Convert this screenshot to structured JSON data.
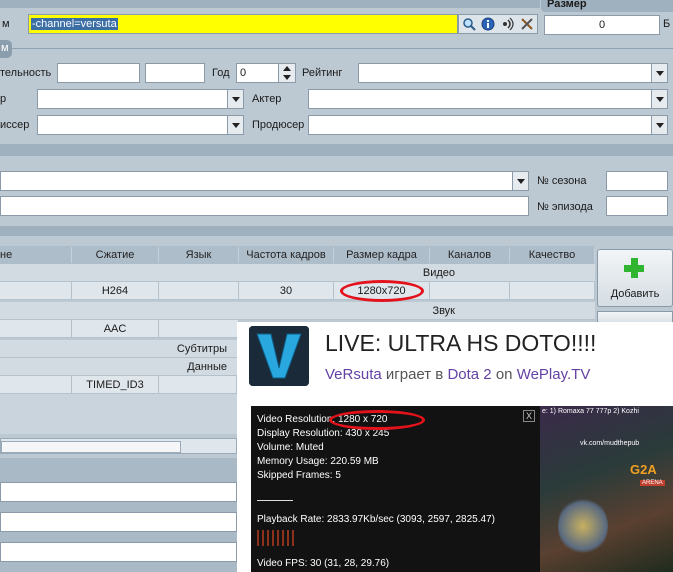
{
  "top": {
    "label_fragment": "м",
    "search_value": "-channel=versuta",
    "size_header": "Размер",
    "size_value": "0",
    "size_unit": "Б",
    "section_tab": "м"
  },
  "details": {
    "duration_label": "тельность",
    "year_label": "Год",
    "year_value": "0",
    "rating_label": "Рейтинг",
    "director_label": "р",
    "actor_label": "Актер",
    "producer_left_label": "иссер",
    "producer_label": "Продюсер"
  },
  "series": {
    "season_label": "№ сезона",
    "episode_label": "№ эпизода"
  },
  "streams": {
    "columns": [
      "не",
      "Сжатие",
      "Язык",
      "Частота кадров",
      "Размер кадра",
      "Каналов",
      "Качество"
    ],
    "video_section": "Видео",
    "video_row": {
      "codec": "H264",
      "fps": "30",
      "frame_size": "1280x720"
    },
    "audio_section": "Звук",
    "audio_row": {
      "codec": "AAC"
    },
    "subs_section": "Субтитры",
    "data_section": "Данные",
    "data_row": {
      "codec": "TIMED_ID3"
    },
    "add_button": "Добавить"
  },
  "stream_card": {
    "logo_letter": "V",
    "title": "LIVE: ULTRA HS DOTO!!!!",
    "channel": "VeRsuta",
    "plays_text": "играет в",
    "game": "Dota 2",
    "on_text": "on",
    "platform": "WePlay.TV"
  },
  "video_stats": {
    "close": "X",
    "resolution": "Video Resolution: 1280 x 720",
    "display_resolution": "Display Resolution: 430 x 245",
    "volume": "Volume: Muted",
    "memory": "Memory Usage: 220.59 MB",
    "skipped": "Skipped Frames: 5",
    "playback_rate": "Playback Rate: 2833.97Kb/sec (3093, 2597, 2825.47)",
    "fps": "Video FPS: 30 (31, 28, 29.76)",
    "game_hud_top": "e: 1) Romaxa 77 777p 2) Kozhi",
    "game_hud_vk": "vk.com/mudthepub",
    "game_brand": "G2A",
    "game_arena": "ARENA"
  },
  "colors": {
    "search_highlight": "#ffff00",
    "selection": "#3a6ea5",
    "annotation_ring": "#e3121b",
    "channel_link": "#6441a5",
    "add_icon": "#2fb52f"
  }
}
